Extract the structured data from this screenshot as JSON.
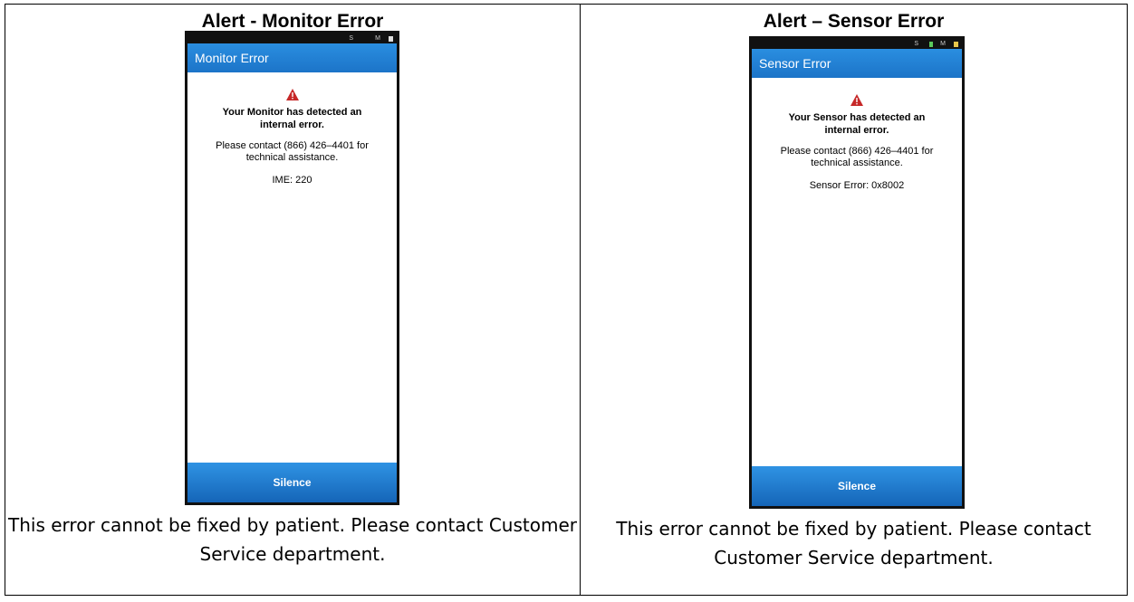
{
  "panels": [
    {
      "title": "Alert - Monitor Error",
      "screen": {
        "status_left": "S",
        "status_right": "M",
        "app_bar_title": "Monitor Error",
        "heading": "Your Monitor has detected an internal error.",
        "body": "Please contact (866) 426–4401 for technical assistance.",
        "code": "IME: 220",
        "button": "Silence"
      },
      "caption": "This error cannot be fixed by patient.  Please contact Customer Service department."
    },
    {
      "title": "Alert – Sensor Error",
      "screen": {
        "status_left": "S",
        "status_right": "M",
        "app_bar_title": "Sensor Error",
        "heading": "Your Sensor has detected an internal error.",
        "body": "Please contact (866) 426–4401 for technical assistance.",
        "code": "Sensor Error: 0x8002",
        "button": "Silence"
      },
      "caption": "This error cannot be fixed by patient.  Please contact Customer Service department."
    }
  ],
  "icons": {
    "warning": "warning-triangle-icon"
  },
  "colors": {
    "app_bar": "#1c74c8",
    "warning": "#c62828",
    "button": "#1f7fd4"
  }
}
